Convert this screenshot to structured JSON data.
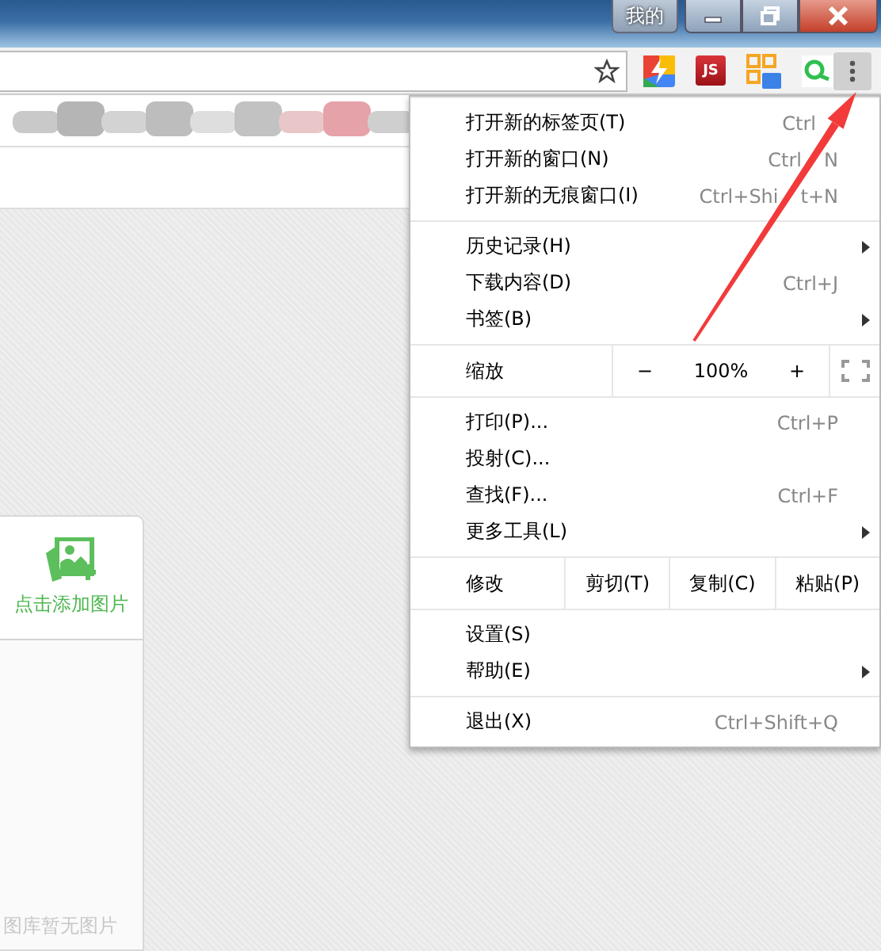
{
  "title_bar": {
    "account_button": "我的"
  },
  "toolbar": {
    "extensions": [
      {
        "kind": "bolt"
      },
      {
        "kind": "js",
        "label": "JS"
      },
      {
        "kind": "qr"
      },
      {
        "kind": "ring"
      }
    ],
    "menu_button": {
      "pressed": true
    }
  },
  "menu": {
    "groups": [
      [
        {
          "kind": "item",
          "label": "打开新的标签页(T)",
          "shortcut": [
            "Ctrl"
          ],
          "shortcut_cut_off": true,
          "submenu": false
        },
        {
          "kind": "item",
          "label": "打开新的窗口(N)",
          "shortcut": [
            "Ctrl",
            "N"
          ],
          "shortcut_cut_off": false,
          "submenu": false
        },
        {
          "kind": "item",
          "label": "打开新的无痕窗口(I)",
          "shortcut": [
            "Ctrl+Shi",
            "t+N"
          ],
          "shortcut_cut_off": false,
          "submenu": false
        }
      ],
      [
        {
          "kind": "item",
          "label": "历史记录(H)",
          "submenu": true
        },
        {
          "kind": "item",
          "label": "下载内容(D)",
          "shortcut": [
            "Ctrl+J"
          ],
          "shortcut_cut_off": false,
          "submenu": false
        },
        {
          "kind": "item",
          "label": "书签(B)",
          "submenu": true
        }
      ],
      [
        {
          "kind": "zoom",
          "label": "缩放",
          "minus": "−",
          "value": "100%",
          "plus": "+"
        }
      ],
      [
        {
          "kind": "item",
          "label": "打印(P)...",
          "shortcut": [
            "Ctrl+P"
          ],
          "shortcut_cut_off": false,
          "submenu": false
        },
        {
          "kind": "item",
          "label": "投射(C)...",
          "submenu": false
        },
        {
          "kind": "item",
          "label": "查找(F)...",
          "shortcut": [
            "Ctrl+F"
          ],
          "shortcut_cut_off": false,
          "submenu": false
        },
        {
          "kind": "item",
          "label": "更多工具(L)",
          "submenu": true
        }
      ],
      [
        {
          "kind": "edit",
          "label": "修改",
          "buttons": [
            "剪切(T)",
            "复制(C)",
            "粘贴(P)"
          ]
        }
      ],
      [
        {
          "kind": "item",
          "label": "设置(S)",
          "submenu": false
        },
        {
          "kind": "item",
          "label": "帮助(E)",
          "submenu": true
        }
      ],
      [
        {
          "kind": "item",
          "label": "退出(X)",
          "shortcut": [
            "Ctrl+Shift+Q"
          ],
          "shortcut_cut_off": false,
          "submenu": false
        }
      ]
    ]
  },
  "page": {
    "upload_label": "点击添加图片",
    "empty_text": "图库暂无图片"
  }
}
